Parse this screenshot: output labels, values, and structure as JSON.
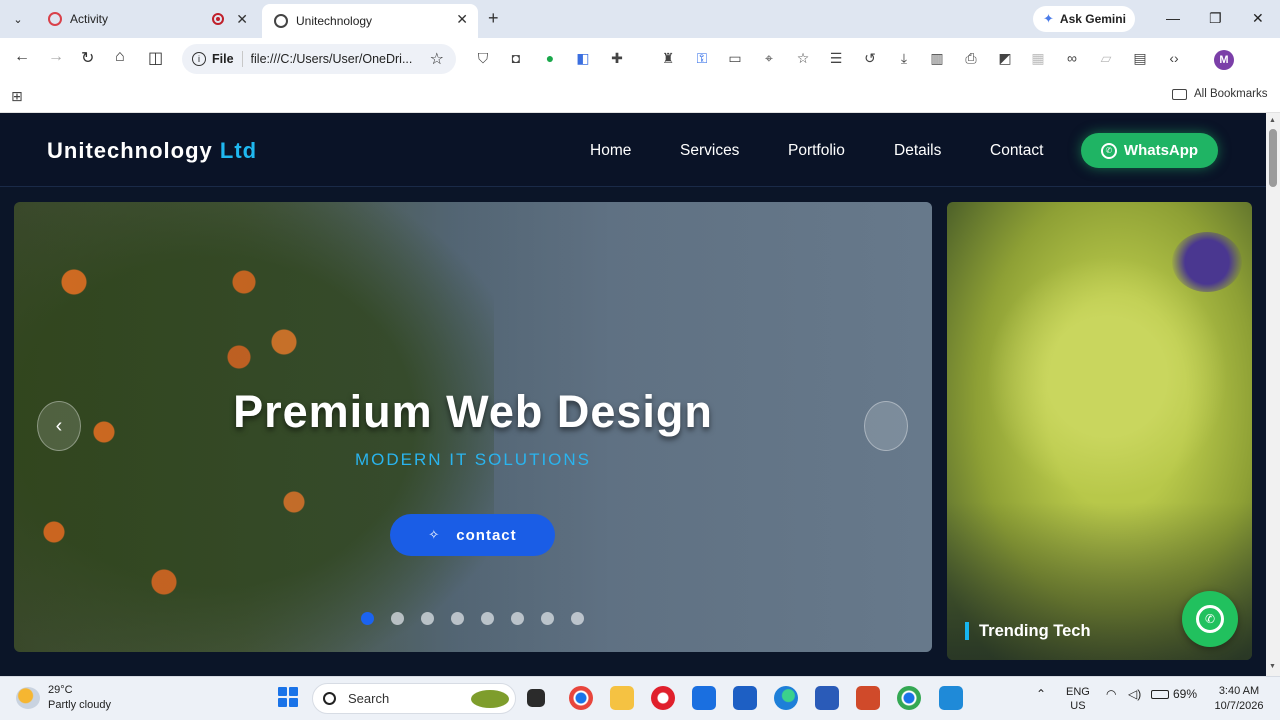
{
  "browser": {
    "tabs": [
      {
        "title": "Activity",
        "active": false
      },
      {
        "title": "Unitechnology",
        "active": true
      }
    ],
    "ask_gemini": "Ask Gemini",
    "address": {
      "scheme": "File",
      "url": "file:///C:/Users/User/OneDri..."
    },
    "profile_initial": "M",
    "bookmarks_label": "All Bookmarks"
  },
  "site": {
    "brand": "Unitechnology",
    "brand_suffix": "Ltd",
    "nav": [
      "Home",
      "Services",
      "Portfolio",
      "Details",
      "Contact"
    ],
    "whatsapp_label": "WhatsApp",
    "hero": {
      "title": "Premium Web Design",
      "subtitle": "MODERN IT SOLUTIONS",
      "cta": "contact",
      "prev_arrow": "‹",
      "slide_count": 8,
      "active_slide": 1
    },
    "side_card_label": "Trending Tech",
    "colors": {
      "accent": "#1fb8f0",
      "whatsapp": "#1fb464",
      "cta": "#1a5de6",
      "header_bg": "#0a1327"
    }
  },
  "taskbar": {
    "weather": {
      "temp": "29°C",
      "desc": "Partly cloudy"
    },
    "search_placeholder": "Search",
    "language": {
      "line1": "ENG",
      "line2": "US"
    },
    "battery": "69%",
    "clock": {
      "time": "3:40 AM",
      "date": "10/7/2026"
    }
  }
}
